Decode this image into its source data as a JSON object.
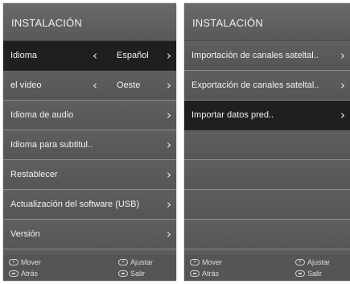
{
  "left_panel": {
    "title": "INSTALACIÓN",
    "items": [
      {
        "label": "Idioma",
        "value": "Español",
        "has_left_arrow": true
      },
      {
        "label": "el vídeo",
        "value": "Oeste",
        "has_left_arrow": true
      },
      {
        "label": "Idioma de audio"
      },
      {
        "label": "Idioma para subtitul.."
      },
      {
        "label": "Restablecer"
      },
      {
        "label": "Actualización del software (USB)"
      },
      {
        "label": "Versión"
      }
    ],
    "selected_index": 0,
    "footer": {
      "move": "Mover",
      "adjust": "Ajustar",
      "back": "Atrás",
      "exit": "Salir"
    }
  },
  "right_panel": {
    "title": "INSTALACIÓN",
    "items": [
      {
        "label": "Importación de canales sateltal.."
      },
      {
        "label": "Exportación de canales sateltal.."
      },
      {
        "label": "Importar datos pred.."
      }
    ],
    "selected_index": 2,
    "footer": {
      "move": "Mover",
      "adjust": "Ajustar",
      "back": "Atrás",
      "exit": "Salir"
    }
  },
  "icons": {
    "right_arrow": "chevron-right-icon",
    "left_arrow": "chevron-left-icon"
  },
  "colors": {
    "panel_bg": "#5b5b5b",
    "selected_row_bg": "#1f1f1f",
    "divider": "#8c8c8c",
    "text": "#f2f2f2"
  }
}
